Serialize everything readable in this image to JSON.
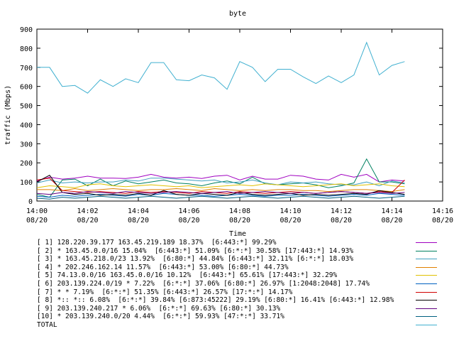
{
  "chart_data": {
    "type": "line",
    "title": "byte",
    "xlabel": "Time",
    "ylabel": "traffic (Mbps)",
    "ylim": [
      0,
      900
    ],
    "yticks": [
      "0",
      "100",
      "200",
      "300",
      "400",
      "500",
      "600",
      "700",
      "800",
      "900"
    ],
    "xticks": [
      {
        "time": "14:00",
        "date": "08/20"
      },
      {
        "time": "14:02",
        "date": "08/20"
      },
      {
        "time": "14:04",
        "date": "08/20"
      },
      {
        "time": "14:06",
        "date": "08/20"
      },
      {
        "time": "14:08",
        "date": "08/20"
      },
      {
        "time": "14:10",
        "date": "08/20"
      },
      {
        "time": "14:12",
        "date": "08/20"
      },
      {
        "time": "14:14",
        "date": "08/20"
      },
      {
        "time": "14:16",
        "date": "08/20"
      }
    ],
    "xlim": [
      "14:00",
      "14:16"
    ],
    "x": [
      "14:00",
      "14:00:30",
      "14:01",
      "14:01:30",
      "14:02",
      "14:02:30",
      "14:03",
      "14:03:30",
      "14:04",
      "14:04:30",
      "14:05",
      "14:05:30",
      "14:06",
      "14:06:30",
      "14:07",
      "14:07:30",
      "14:08",
      "14:08:30",
      "14:09",
      "14:09:30",
      "14:10",
      "14:10:30",
      "14:11",
      "14:11:30",
      "14:12",
      "14:12:30",
      "14:13",
      "14:13:30",
      "14:14",
      "14:14:30"
    ],
    "grid": false,
    "legend_position": "bottom",
    "series": [
      {
        "name": "[ 1] 128.220.39.177 163.45.219.189 18.37%  [6:443:*] 99.29%",
        "color": "#a000c0",
        "values": [
          105,
          125,
          115,
          120,
          130,
          120,
          120,
          118,
          125,
          140,
          125,
          120,
          125,
          118,
          130,
          135,
          110,
          130,
          115,
          115,
          135,
          130,
          115,
          110,
          140,
          125,
          140,
          100,
          110,
          105
        ]
      },
      {
        "name": "[ 2] * 163.45.0.0/16 15.04%  [6:443:*] 51.09% [6:*:*] 30.58% [17:443:*] 14.93%",
        "color": "#008060",
        "values": [
          35,
          20,
          110,
          115,
          80,
          115,
          80,
          105,
          90,
          100,
          110,
          95,
          90,
          80,
          95,
          105,
          90,
          125,
          90,
          85,
          90,
          95,
          85,
          70,
          80,
          95,
          220,
          100,
          100,
          90
        ]
      },
      {
        "name": "[ 3] * 163.45.218.0/23 13.92%  [6:80:*] 44.84% [6:443:*] 32.11% [6:*:*] 18.03%",
        "color": "#40a0c0",
        "values": [
          95,
          110,
          95,
          100,
          95,
          100,
          100,
          110,
          105,
          120,
          120,
          115,
          110,
          105,
          110,
          95,
          100,
          110,
          95,
          85,
          100,
          95,
          100,
          90,
          85,
          85,
          100,
          80,
          105,
          95
        ]
      },
      {
        "name": "[ 4] * 202.246.162.14 11.57%  [6:443:*] 53.00% [6:80:*] 44.73%",
        "color": "#e08000",
        "values": [
          60,
          60,
          55,
          65,
          55,
          60,
          65,
          60,
          55,
          60,
          60,
          65,
          60,
          55,
          65,
          60,
          55,
          60,
          55,
          60,
          60,
          55,
          55,
          50,
          55,
          60,
          60,
          55,
          50,
          60
        ]
      },
      {
        "name": "[ 5] 74.13.0.0/16 163.45.0.0/16 10.12%  [6:443:*] 65.61% [17:443:*] 32.29%",
        "color": "#e0c000",
        "values": [
          70,
          80,
          75,
          70,
          85,
          90,
          80,
          75,
          80,
          85,
          80,
          75,
          80,
          70,
          75,
          80,
          85,
          80,
          90,
          85,
          80,
          75,
          80,
          85,
          90,
          80,
          85,
          90,
          80,
          75
        ]
      },
      {
        "name": "[ 6] 203.139.224.0/19 * 7.22%  [6:*:*] 37.06% [6:80:*] 26.97% [1:2048:2048] 17.74%",
        "color": "#0060c0",
        "values": [
          25,
          20,
          30,
          25,
          30,
          35,
          30,
          25,
          35,
          30,
          40,
          35,
          30,
          30,
          25,
          30,
          35,
          30,
          25,
          30,
          30,
          35,
          30,
          25,
          30,
          35,
          30,
          40,
          35,
          30
        ]
      },
      {
        "name": "[ 7] * * 7.19%  [6:*:*] 51.35% [6:443:*] 26.57% [17:*:*] 14.17%",
        "color": "#d00000",
        "values": [
          110,
          120,
          55,
          50,
          45,
          50,
          45,
          40,
          50,
          45,
          50,
          45,
          40,
          50,
          45,
          40,
          50,
          45,
          40,
          45,
          50,
          45,
          40,
          45,
          50,
          45,
          40,
          50,
          45,
          110
        ]
      },
      {
        "name": "[ 8] *:: *:: 6.08%  [6:*:*] 39.84% [6:873:45222] 29.19% [6:80:*] 16.41% [6:443:*] 12.98%",
        "color": "#000000",
        "values": [
          100,
          135,
          45,
          35,
          40,
          30,
          35,
          30,
          40,
          30,
          55,
          35,
          30,
          40,
          35,
          30,
          45,
          35,
          30,
          35,
          40,
          30,
          35,
          30,
          35,
          40,
          35,
          55,
          45,
          35
        ]
      },
      {
        "name": "[ 9] 203.139.240.217 * 6.06%  [6:*:*] 69.63% [6:80:*] 30.13%",
        "color": "#600080",
        "values": [
          40,
          35,
          45,
          40,
          50,
          45,
          40,
          50,
          45,
          40,
          45,
          50,
          45,
          40,
          45,
          50,
          40,
          45,
          50,
          45,
          40,
          45,
          40,
          45,
          50,
          45,
          40,
          45,
          40,
          45
        ]
      },
      {
        "name": "[10] * 203.139.240.0/20 4.44%  [6:*:*] 59.93% [47:*:*] 33.71%",
        "color": "#006080",
        "values": [
          15,
          10,
          20,
          15,
          20,
          25,
          20,
          15,
          20,
          25,
          20,
          15,
          20,
          25,
          20,
          15,
          20,
          25,
          20,
          15,
          20,
          25,
          20,
          15,
          20,
          25,
          20,
          15,
          20,
          25
        ]
      },
      {
        "name": "TOTAL",
        "color": "#40b0d0",
        "values": [
          700,
          700,
          600,
          605,
          565,
          635,
          600,
          640,
          620,
          725,
          725,
          635,
          630,
          660,
          645,
          585,
          730,
          700,
          625,
          690,
          690,
          650,
          615,
          655,
          620,
          660,
          830,
          660,
          710,
          730
        ]
      }
    ]
  }
}
